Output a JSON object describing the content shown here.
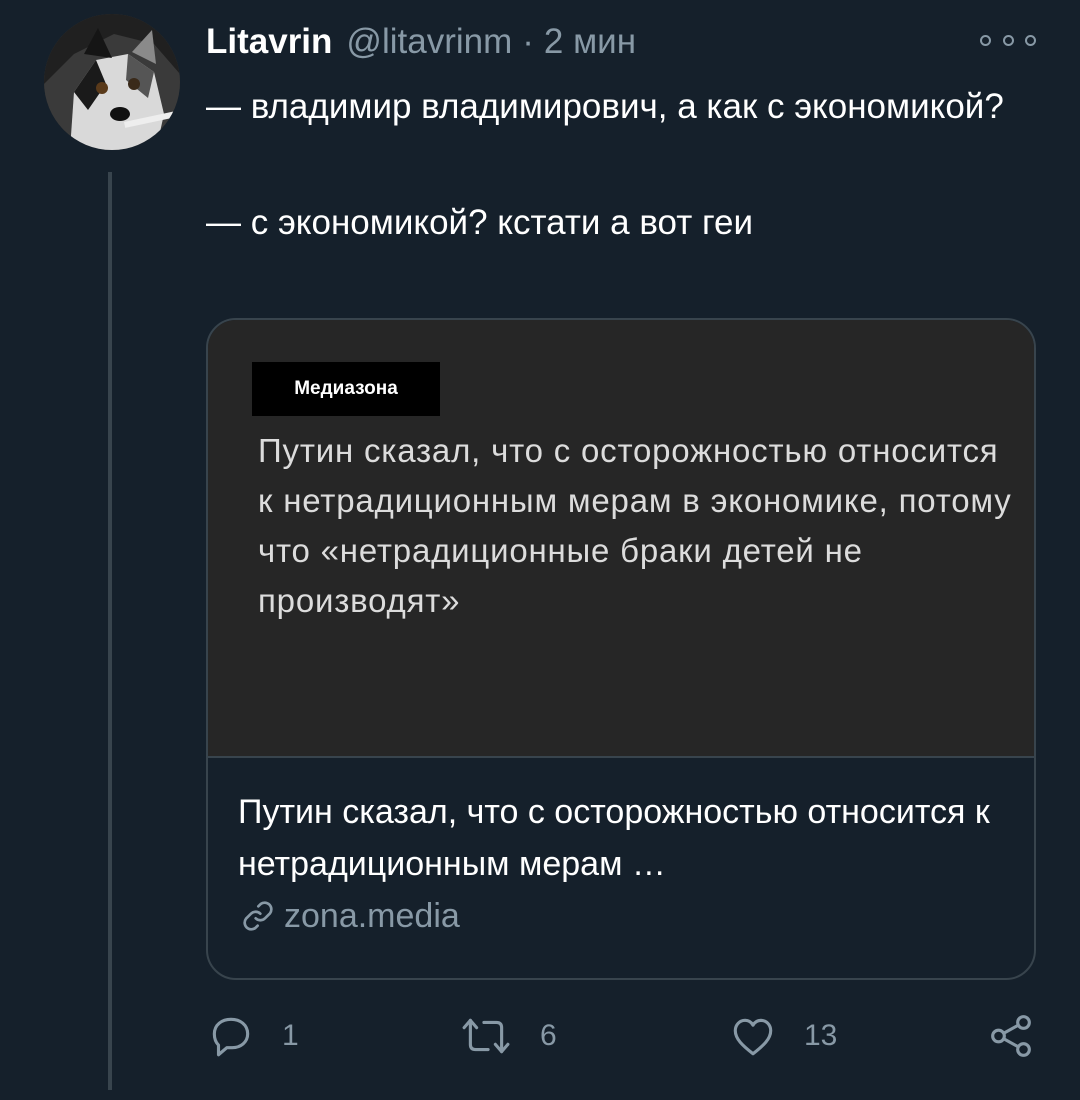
{
  "tweet": {
    "display_name": "Litavrin",
    "handle": "@litavrinm",
    "separator": "·",
    "time": "2 мин",
    "text": "— владимир владимирович, а как с экономикой?\n\n— с экономикой? кстати а вот геи",
    "avatar_icon": "dog-avatar",
    "more_icon": "more-options-icon"
  },
  "card": {
    "image": {
      "logo_text": "Медиазона",
      "headline": "Путин сказал, что с осторожностью относится к нетрадиционным мерам в экономике, потому что «нетрадиционные браки детей не производят»"
    },
    "title": "Путин сказал, что с осторожностью относится к нетрадиционным мерам …",
    "domain": "zona.media",
    "domain_icon": "link-icon"
  },
  "actions": {
    "reply": {
      "icon": "reply-icon",
      "count": "1"
    },
    "retweet": {
      "icon": "retweet-icon",
      "count": "6"
    },
    "like": {
      "icon": "heart-icon",
      "count": "13"
    },
    "share": {
      "icon": "share-icon"
    }
  },
  "colors": {
    "background": "#15202b",
    "secondary_text": "#8899a6",
    "border": "#38444d",
    "card_image_bg": "#262626"
  }
}
